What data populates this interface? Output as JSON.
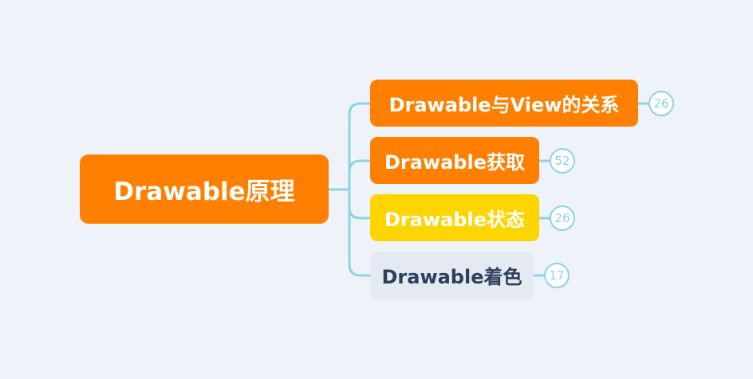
{
  "root": {
    "label": "Drawable原理",
    "color": "#ff7f00",
    "text_color": "#ffffff"
  },
  "branches": [
    {
      "label": "Drawable与View的关系",
      "count": "26",
      "color": "#ff7f00",
      "text_color": "#ffffff"
    },
    {
      "label": "Drawable获取",
      "count": "52",
      "color": "#ff7f00",
      "text_color": "#ffffff"
    },
    {
      "label": "Drawable状态",
      "count": "26",
      "color": "#ffd500",
      "text_color": "#ffffff"
    },
    {
      "label": "Drawable着色",
      "count": "17",
      "color": "#e3eaf2",
      "text_color": "#2e3f5c"
    }
  ],
  "connector_color": "#8dd3e3",
  "background_color": "#edf3f9"
}
